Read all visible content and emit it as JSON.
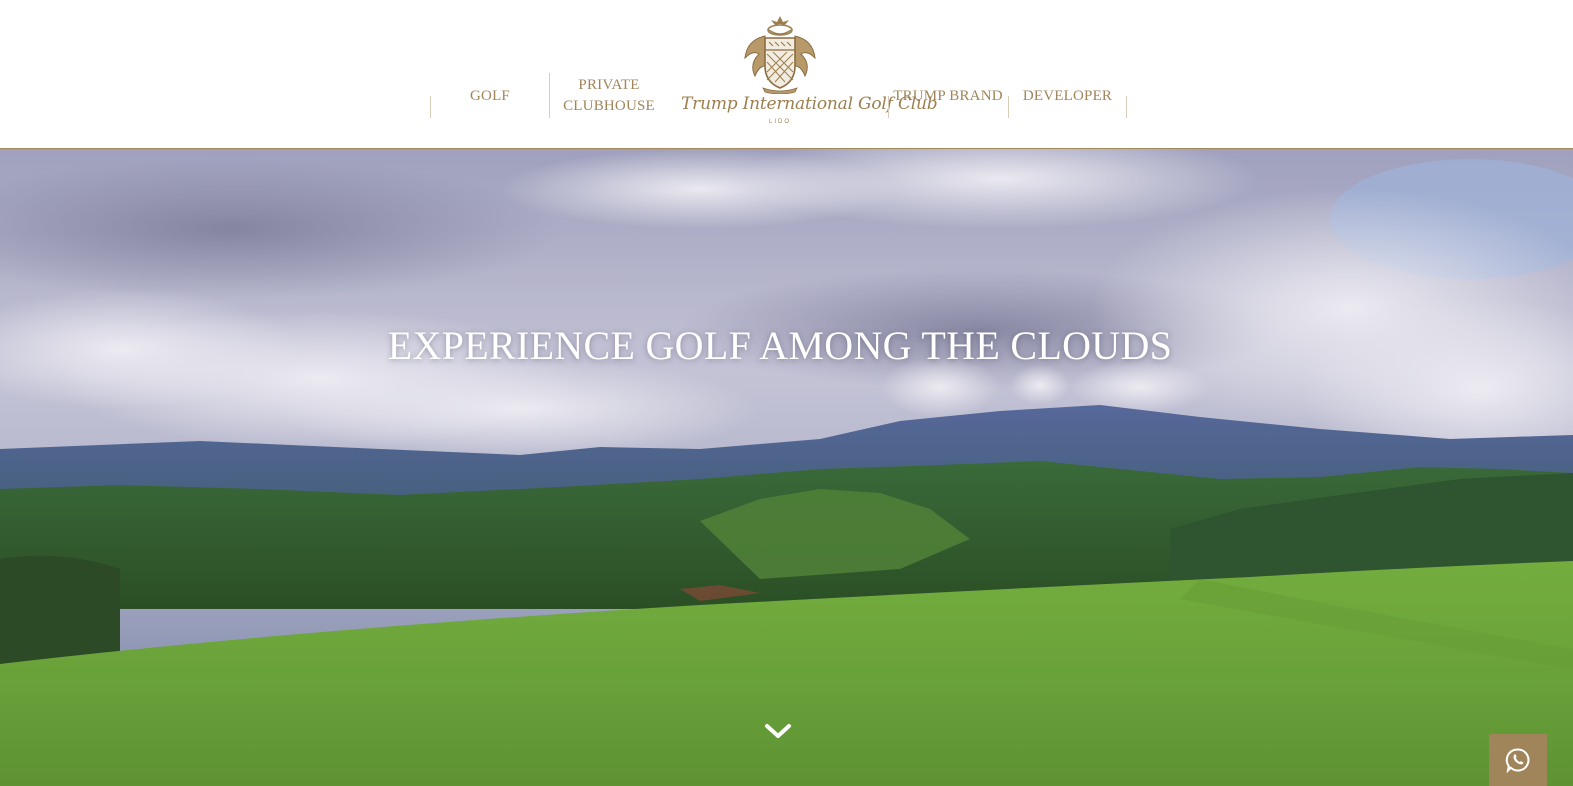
{
  "header": {
    "logo": {
      "name": "Trump International Golf Club",
      "location": "LIDO"
    },
    "nav": {
      "golf": "GOLF",
      "private_clubhouse_line1": "PRIVATE",
      "private_clubhouse_line2": "CLUBHOUSE",
      "trump_brand": "TRUMP BRAND",
      "developer": "DEVELOPER"
    }
  },
  "hero": {
    "headline": "EXPERIENCE GOLF AMONG THE CLOUDS",
    "scroll_icon": "chevron-down-icon"
  },
  "floating": {
    "whatsapp_icon": "whatsapp-icon"
  },
  "colors": {
    "gold": "#a0855a",
    "divider": "#d8ccb8",
    "header_bg": "#ffffff"
  }
}
